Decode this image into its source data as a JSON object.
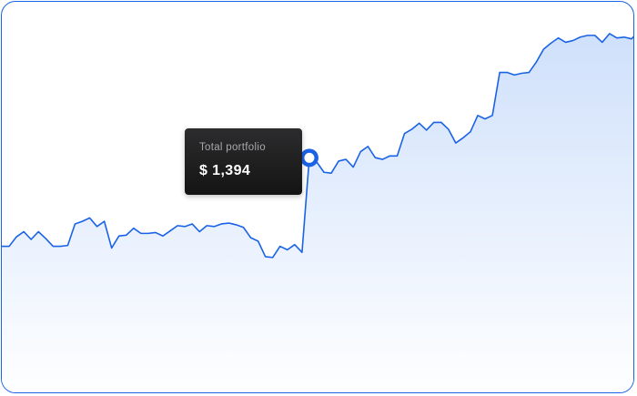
{
  "chart_data": {
    "type": "area",
    "line_color": "#1a63e6",
    "fill_color_top": "#cfe0fb",
    "fill_color_bottom": "#ffffff",
    "ylim": [
      0,
      2300
    ],
    "values": [
      880,
      880,
      935,
      965,
      920,
      965,
      925,
      880,
      880,
      885,
      1010,
      1025,
      1045,
      995,
      1025,
      870,
      940,
      945,
      985,
      955,
      955,
      960,
      940,
      970,
      1000,
      995,
      1010,
      965,
      1000,
      995,
      1010,
      1015,
      1005,
      990,
      930,
      910,
      820,
      815,
      880,
      860,
      890,
      845,
      1394,
      1370,
      1310,
      1305,
      1375,
      1385,
      1340,
      1430,
      1460,
      1395,
      1385,
      1405,
      1405,
      1535,
      1560,
      1595,
      1555,
      1600,
      1600,
      1560,
      1480,
      1510,
      1545,
      1640,
      1620,
      1640,
      1890,
      1890,
      1875,
      1885,
      1890,
      1950,
      2025,
      2060,
      2090,
      2065,
      2075,
      2095,
      2105,
      2105,
      2065,
      2115,
      2090,
      2095,
      2085,
      2130
    ],
    "highlight_index": 42,
    "highlight_value": 1394
  },
  "tooltip": {
    "label": "Total portfolio",
    "value": "$ 1,394"
  }
}
